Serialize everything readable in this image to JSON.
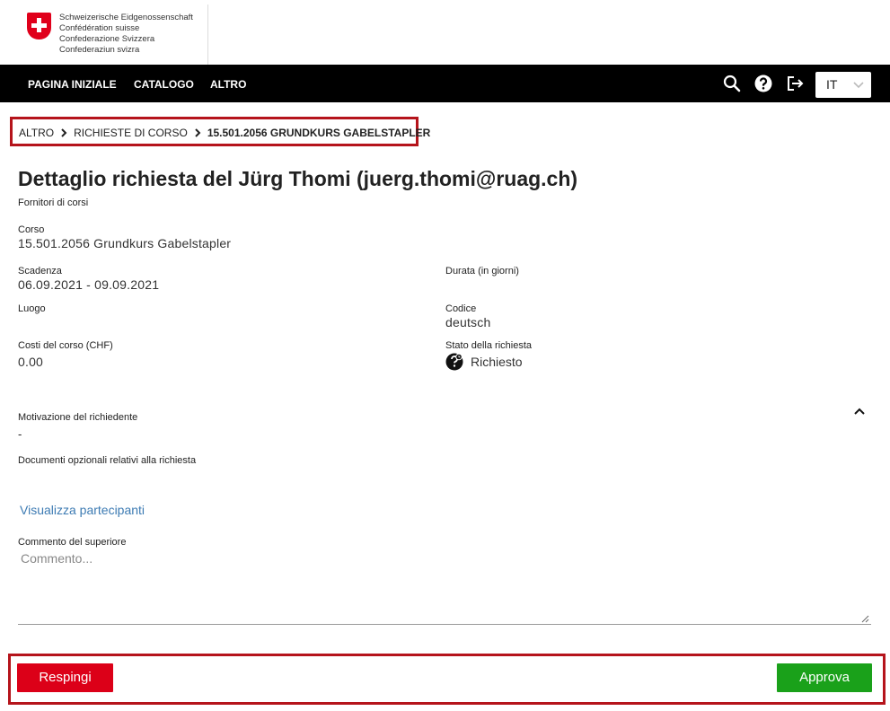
{
  "header": {
    "logo_lines": [
      "Schweizerische Eidgenossenschaft",
      "Confédération suisse",
      "Confederazione Svizzera",
      "Confederaziun svizra"
    ],
    "nav": [
      "PAGINA INIZIALE",
      "CATALOGO",
      "ALTRO"
    ],
    "icons": [
      "search-icon",
      "help-icon",
      "logout-icon"
    ],
    "language": "IT"
  },
  "breadcrumb": {
    "items": [
      "ALTRO",
      "RICHIESTE DI CORSO"
    ],
    "current": "15.501.2056 GRUNDKURS GABELSTAPLER"
  },
  "detail": {
    "title": "Dettaglio richiesta del Jürg Thomi (juerg.thomi@ruag.ch)",
    "subtitle": "Fornitori di corsi",
    "course_label": "Corso",
    "course_value": "15.501.2056 Grundkurs Gabelstapler",
    "deadline_label": "Scadenza",
    "deadline_value": "06.09.2021 - 09.09.2021",
    "duration_label": "Durata (in giorni)",
    "place_label": "Luogo",
    "code_label": "Codice",
    "code_value": "deutsch",
    "cost_label": "Costi del corso (CHF)",
    "cost_value": "0.00",
    "status_label": "Stato della richiesta",
    "status_value": "Richiesto",
    "motivation_label": "Motivazione del richiedente",
    "motivation_value": "-",
    "documents_label": "Documenti opzionali relativi alla richiesta",
    "participants_link": "Visualizza partecipanti",
    "comment_label": "Commento del superiore",
    "comment_placeholder": "Commento..."
  },
  "actions": {
    "reject": "Respingi",
    "approve": "Approva"
  },
  "colors": {
    "highlight_border": "#b5141b",
    "reject": "#dc0018",
    "approve": "#1aa11a",
    "link": "#3d7bb3",
    "navbar": "#000000"
  }
}
